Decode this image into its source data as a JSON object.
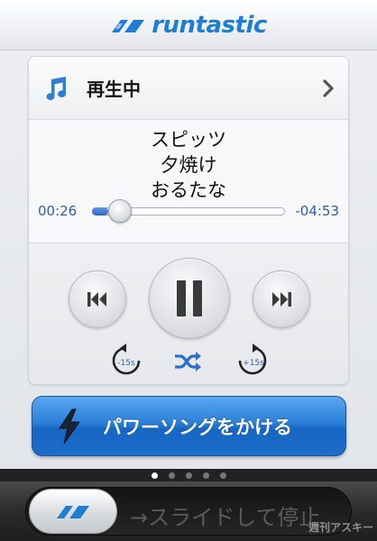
{
  "app": {
    "logo_text": "runtastic"
  },
  "player": {
    "status_title": "再生中",
    "artist": "スピッツ",
    "song": "夕焼け",
    "album": "おるたな",
    "elapsed": "00:26",
    "remaining": "-04:53",
    "progress_fraction": 0.084,
    "rewind_label": "-15s",
    "forward_label": "+15s"
  },
  "power_song": {
    "label": "パワーソングをかける"
  },
  "pager": {
    "pages": 5,
    "active_index": 0
  },
  "slide": {
    "label": "→スライドして停止"
  },
  "watermark": "週刊アスキー",
  "colors": {
    "accent": "#2b7fd8",
    "time_text": "#2c5fae"
  }
}
